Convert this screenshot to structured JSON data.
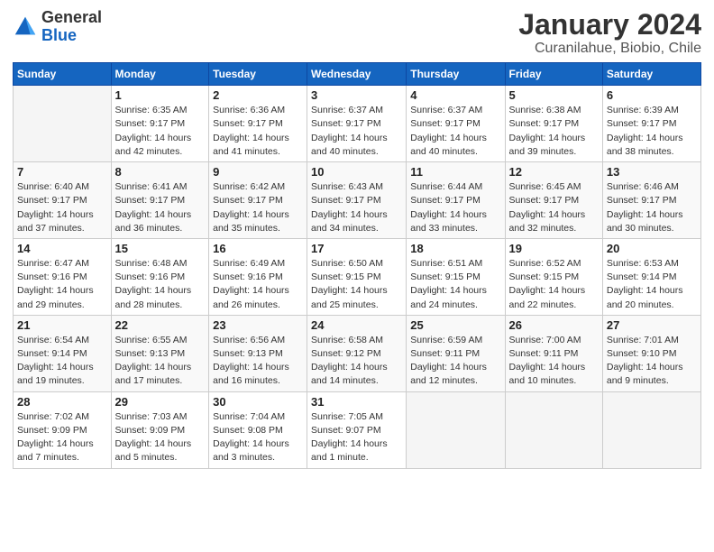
{
  "logo": {
    "general": "General",
    "blue": "Blue"
  },
  "header": {
    "month": "January 2024",
    "location": "Curanilahue, Biobio, Chile"
  },
  "weekdays": [
    "Sunday",
    "Monday",
    "Tuesday",
    "Wednesday",
    "Thursday",
    "Friday",
    "Saturday"
  ],
  "weeks": [
    [
      {
        "day": "",
        "info": ""
      },
      {
        "day": "1",
        "info": "Sunrise: 6:35 AM\nSunset: 9:17 PM\nDaylight: 14 hours\nand 42 minutes."
      },
      {
        "day": "2",
        "info": "Sunrise: 6:36 AM\nSunset: 9:17 PM\nDaylight: 14 hours\nand 41 minutes."
      },
      {
        "day": "3",
        "info": "Sunrise: 6:37 AM\nSunset: 9:17 PM\nDaylight: 14 hours\nand 40 minutes."
      },
      {
        "day": "4",
        "info": "Sunrise: 6:37 AM\nSunset: 9:17 PM\nDaylight: 14 hours\nand 40 minutes."
      },
      {
        "day": "5",
        "info": "Sunrise: 6:38 AM\nSunset: 9:17 PM\nDaylight: 14 hours\nand 39 minutes."
      },
      {
        "day": "6",
        "info": "Sunrise: 6:39 AM\nSunset: 9:17 PM\nDaylight: 14 hours\nand 38 minutes."
      }
    ],
    [
      {
        "day": "7",
        "info": "Sunrise: 6:40 AM\nSunset: 9:17 PM\nDaylight: 14 hours\nand 37 minutes."
      },
      {
        "day": "8",
        "info": "Sunrise: 6:41 AM\nSunset: 9:17 PM\nDaylight: 14 hours\nand 36 minutes."
      },
      {
        "day": "9",
        "info": "Sunrise: 6:42 AM\nSunset: 9:17 PM\nDaylight: 14 hours\nand 35 minutes."
      },
      {
        "day": "10",
        "info": "Sunrise: 6:43 AM\nSunset: 9:17 PM\nDaylight: 14 hours\nand 34 minutes."
      },
      {
        "day": "11",
        "info": "Sunrise: 6:44 AM\nSunset: 9:17 PM\nDaylight: 14 hours\nand 33 minutes."
      },
      {
        "day": "12",
        "info": "Sunrise: 6:45 AM\nSunset: 9:17 PM\nDaylight: 14 hours\nand 32 minutes."
      },
      {
        "day": "13",
        "info": "Sunrise: 6:46 AM\nSunset: 9:17 PM\nDaylight: 14 hours\nand 30 minutes."
      }
    ],
    [
      {
        "day": "14",
        "info": "Sunrise: 6:47 AM\nSunset: 9:16 PM\nDaylight: 14 hours\nand 29 minutes."
      },
      {
        "day": "15",
        "info": "Sunrise: 6:48 AM\nSunset: 9:16 PM\nDaylight: 14 hours\nand 28 minutes."
      },
      {
        "day": "16",
        "info": "Sunrise: 6:49 AM\nSunset: 9:16 PM\nDaylight: 14 hours\nand 26 minutes."
      },
      {
        "day": "17",
        "info": "Sunrise: 6:50 AM\nSunset: 9:15 PM\nDaylight: 14 hours\nand 25 minutes."
      },
      {
        "day": "18",
        "info": "Sunrise: 6:51 AM\nSunset: 9:15 PM\nDaylight: 14 hours\nand 24 minutes."
      },
      {
        "day": "19",
        "info": "Sunrise: 6:52 AM\nSunset: 9:15 PM\nDaylight: 14 hours\nand 22 minutes."
      },
      {
        "day": "20",
        "info": "Sunrise: 6:53 AM\nSunset: 9:14 PM\nDaylight: 14 hours\nand 20 minutes."
      }
    ],
    [
      {
        "day": "21",
        "info": "Sunrise: 6:54 AM\nSunset: 9:14 PM\nDaylight: 14 hours\nand 19 minutes."
      },
      {
        "day": "22",
        "info": "Sunrise: 6:55 AM\nSunset: 9:13 PM\nDaylight: 14 hours\nand 17 minutes."
      },
      {
        "day": "23",
        "info": "Sunrise: 6:56 AM\nSunset: 9:13 PM\nDaylight: 14 hours\nand 16 minutes."
      },
      {
        "day": "24",
        "info": "Sunrise: 6:58 AM\nSunset: 9:12 PM\nDaylight: 14 hours\nand 14 minutes."
      },
      {
        "day": "25",
        "info": "Sunrise: 6:59 AM\nSunset: 9:11 PM\nDaylight: 14 hours\nand 12 minutes."
      },
      {
        "day": "26",
        "info": "Sunrise: 7:00 AM\nSunset: 9:11 PM\nDaylight: 14 hours\nand 10 minutes."
      },
      {
        "day": "27",
        "info": "Sunrise: 7:01 AM\nSunset: 9:10 PM\nDaylight: 14 hours\nand 9 minutes."
      }
    ],
    [
      {
        "day": "28",
        "info": "Sunrise: 7:02 AM\nSunset: 9:09 PM\nDaylight: 14 hours\nand 7 minutes."
      },
      {
        "day": "29",
        "info": "Sunrise: 7:03 AM\nSunset: 9:09 PM\nDaylight: 14 hours\nand 5 minutes."
      },
      {
        "day": "30",
        "info": "Sunrise: 7:04 AM\nSunset: 9:08 PM\nDaylight: 14 hours\nand 3 minutes."
      },
      {
        "day": "31",
        "info": "Sunrise: 7:05 AM\nSunset: 9:07 PM\nDaylight: 14 hours\nand 1 minute."
      },
      {
        "day": "",
        "info": ""
      },
      {
        "day": "",
        "info": ""
      },
      {
        "day": "",
        "info": ""
      }
    ]
  ]
}
